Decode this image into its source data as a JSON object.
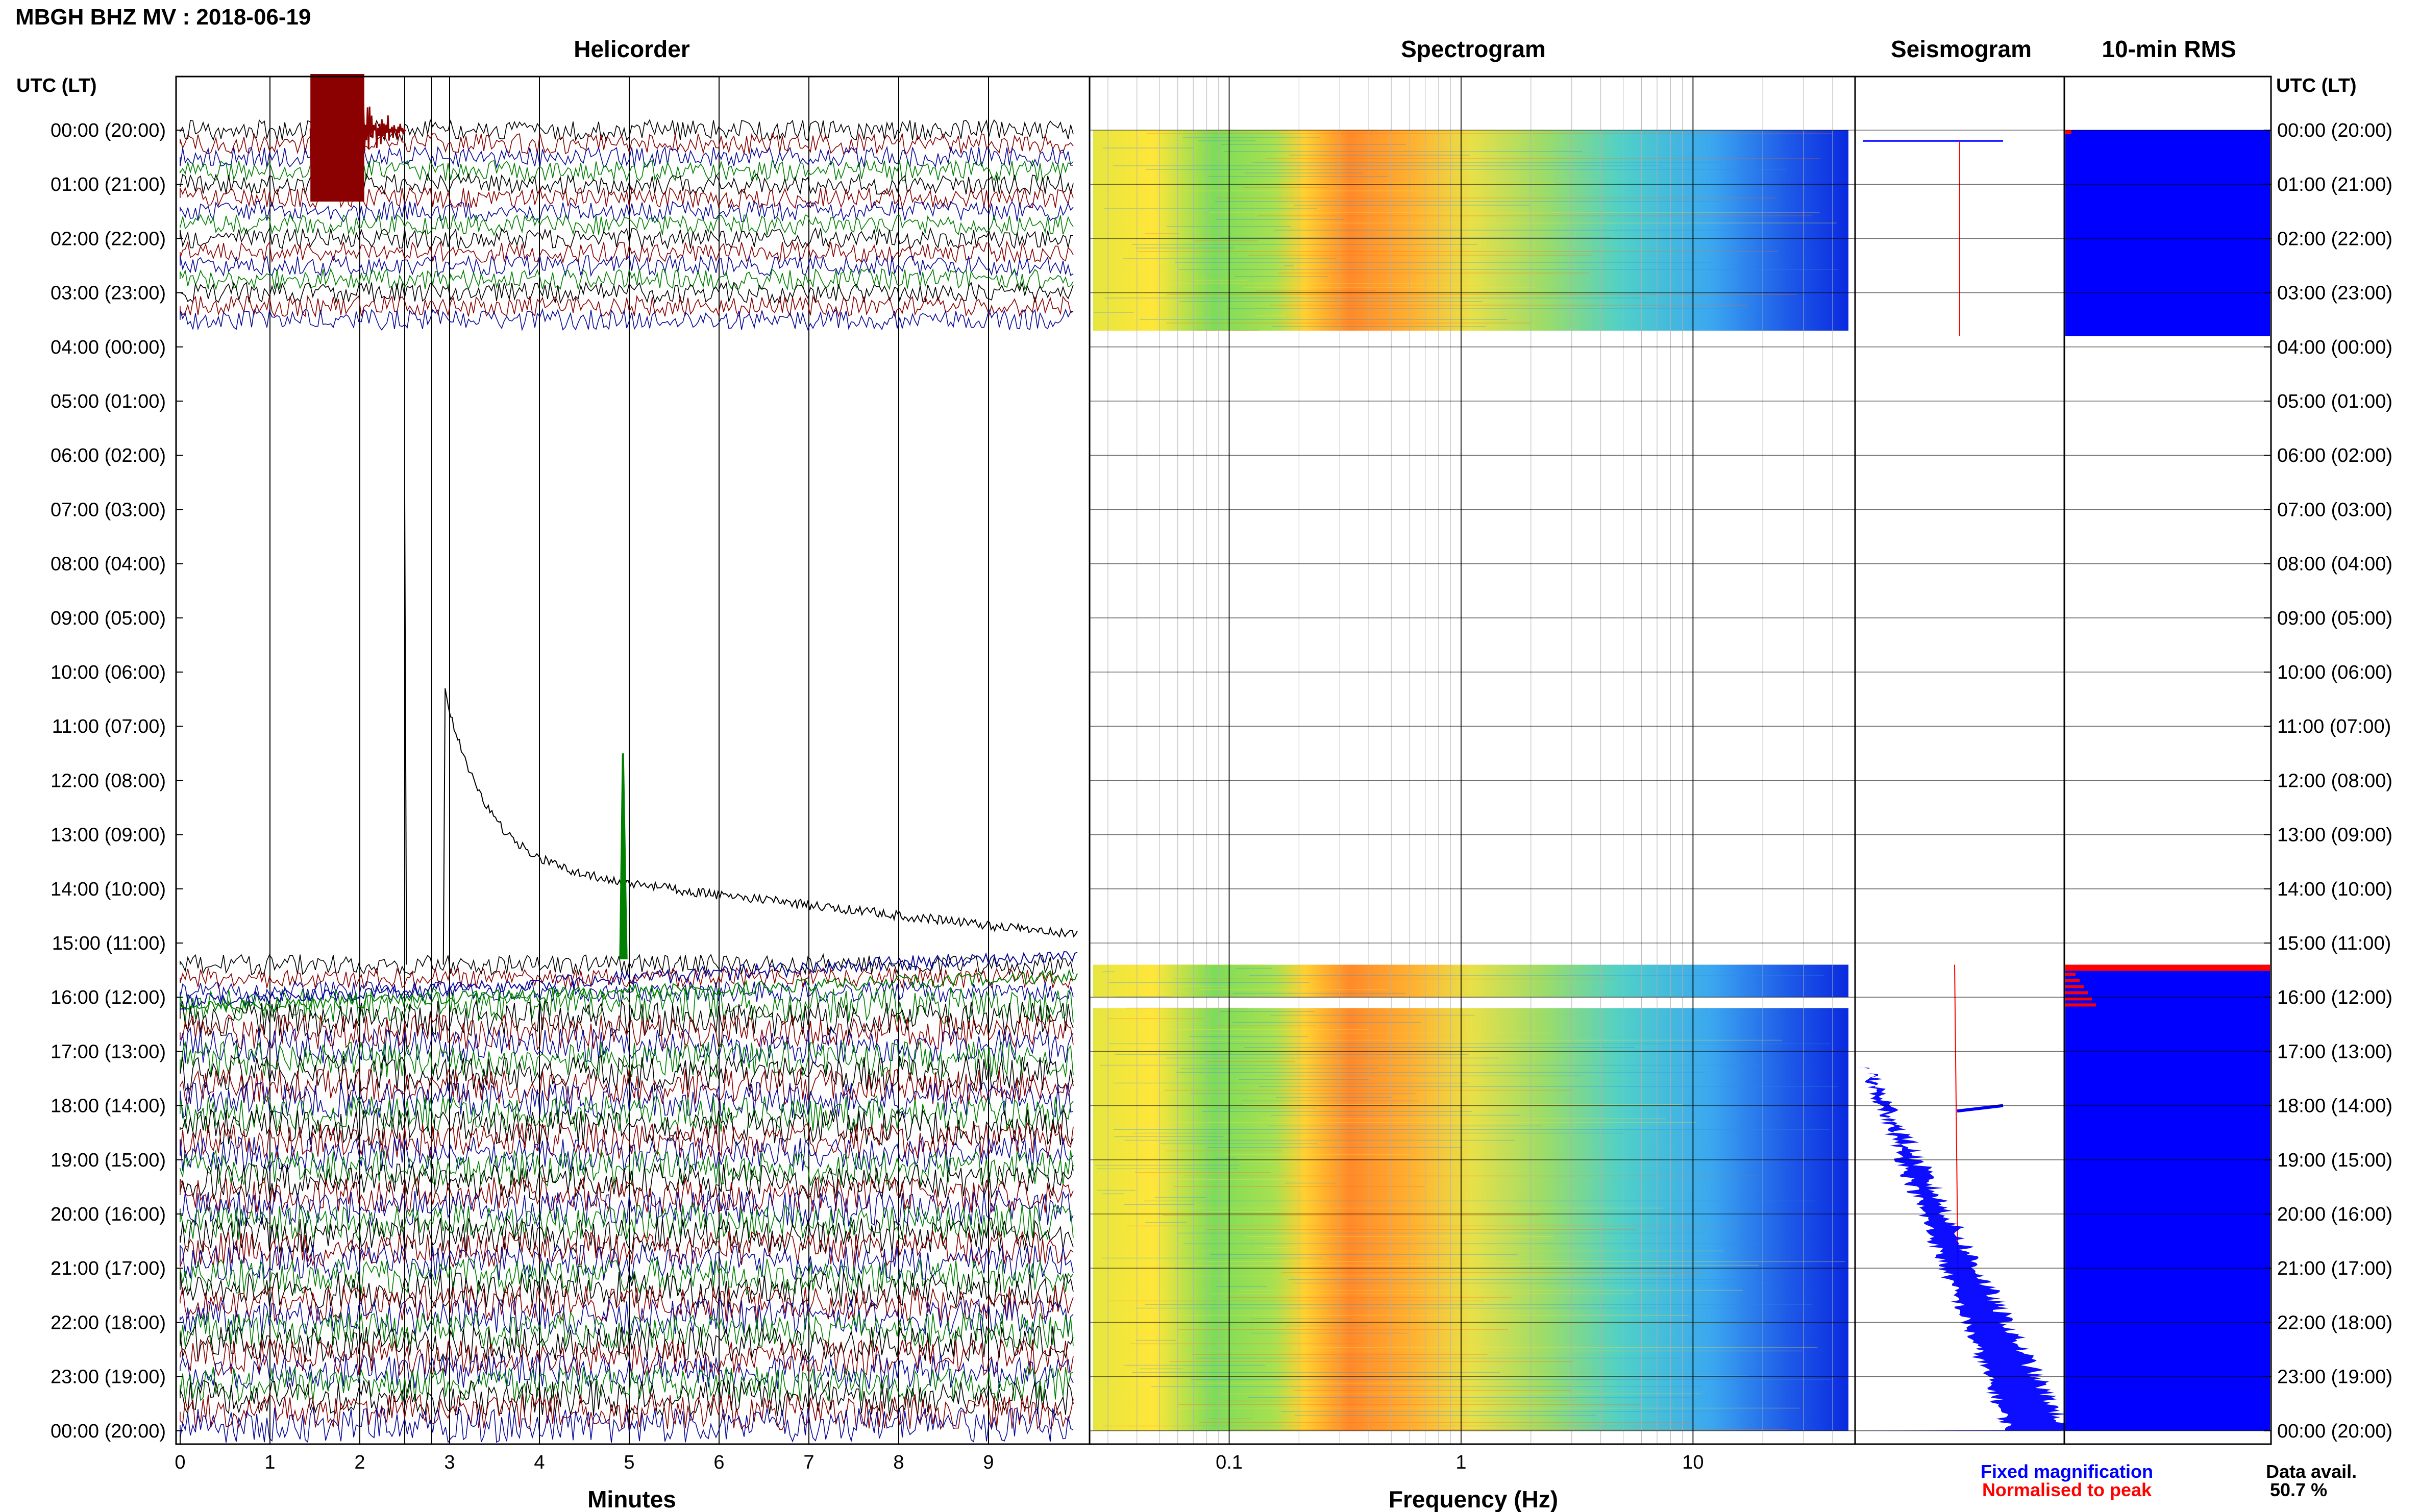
{
  "header": {
    "station_title": "MBGH BHZ MV : 2018-06-19"
  },
  "panels": {
    "helicorder_title": "Helicorder",
    "spectrogram_title": "Spectrogram",
    "seismogram_title": "Seismogram",
    "rms_title": "10-min RMS"
  },
  "time_axis": {
    "left_header": "UTC (LT)",
    "right_header": "UTC (LT)",
    "rows": [
      "00:00 (20:00)",
      "01:00 (21:00)",
      "02:00 (22:00)",
      "03:00 (23:00)",
      "04:00 (00:00)",
      "05:00 (01:00)",
      "06:00 (02:00)",
      "07:00 (03:00)",
      "08:00 (04:00)",
      "09:00 (05:00)",
      "10:00 (06:00)",
      "11:00 (07:00)",
      "12:00 (08:00)",
      "13:00 (09:00)",
      "14:00 (10:00)",
      "15:00 (11:00)",
      "16:00 (12:00)",
      "17:00 (13:00)",
      "18:00 (14:00)",
      "19:00 (15:00)",
      "20:00 (16:00)",
      "21:00 (17:00)",
      "22:00 (18:00)",
      "23:00 (19:00)",
      "00:00 (20:00)"
    ]
  },
  "x_axes": {
    "minutes_label": "Minutes",
    "minutes_ticks": [
      "0",
      "1",
      "2",
      "3",
      "4",
      "5",
      "6",
      "7",
      "8",
      "9"
    ],
    "frequency_label": "Frequency (Hz)",
    "frequency_ticks": [
      "0.1",
      "1",
      "10"
    ]
  },
  "legend": {
    "fixed": "Fixed magnification",
    "normalised": "Normalised to peak",
    "data_avail_label": "Data avail.",
    "data_avail_value": "50.7 %"
  },
  "colors": {
    "trace_black": "#000000",
    "trace_red": "#8b0000",
    "trace_blue": "#0a0a9a",
    "trace_green": "#008000",
    "fixed_blue": "#0000ff",
    "normalised_red": "#ff0000",
    "grid": "#000000"
  },
  "chart_data": [
    {
      "type": "line",
      "title": "Helicorder",
      "xlabel": "Minutes",
      "xlim": [
        0,
        10
      ],
      "y_unit": "hour of day (UTC)",
      "ylim": [
        0,
        24
      ],
      "data_segments_hours": [
        [
          0,
          3.7
        ],
        [
          15.4,
          24
        ]
      ],
      "series_colors_cycle": [
        "black",
        "red",
        "blue",
        "green"
      ],
      "events": [
        {
          "hour": 0,
          "minute_start": 1.45,
          "minute_end": 2.5,
          "description": "large red burst"
        },
        {
          "hour": 10.3,
          "minute_start": 2.9,
          "minute_end": 10,
          "description": "black decaying transient"
        },
        {
          "hour": 11.5,
          "minute_start": 4.9,
          "minute_end": 5.0,
          "description": "green spike"
        }
      ]
    },
    {
      "type": "heatmap",
      "title": "Spectrogram",
      "xlabel": "Frequency (Hz)",
      "x_scale": "log",
      "xlim": [
        0.025,
        50
      ],
      "ylim": [
        0,
        24
      ],
      "data_segments_hours": [
        [
          0,
          3.7
        ],
        [
          15.4,
          16.0
        ],
        [
          16.2,
          24
        ]
      ],
      "peak_band_hz": [
        0.25,
        0.6
      ]
    },
    {
      "type": "line",
      "title": "Seismogram",
      "ylim": [
        0,
        24
      ],
      "series": [
        {
          "name": "Fixed magnification",
          "description": "blue amplitude growing from ~17h to 24h"
        },
        {
          "name": "Normalised to peak",
          "description": "red near-constant line"
        }
      ]
    },
    {
      "type": "bar",
      "title": "10-min RMS",
      "ylim": [
        0,
        24
      ],
      "filled_hours": [
        [
          0,
          3.8
        ],
        [
          15.4,
          24
        ]
      ],
      "normalised_peak_hours": [
        0,
        15.4
      ]
    }
  ]
}
